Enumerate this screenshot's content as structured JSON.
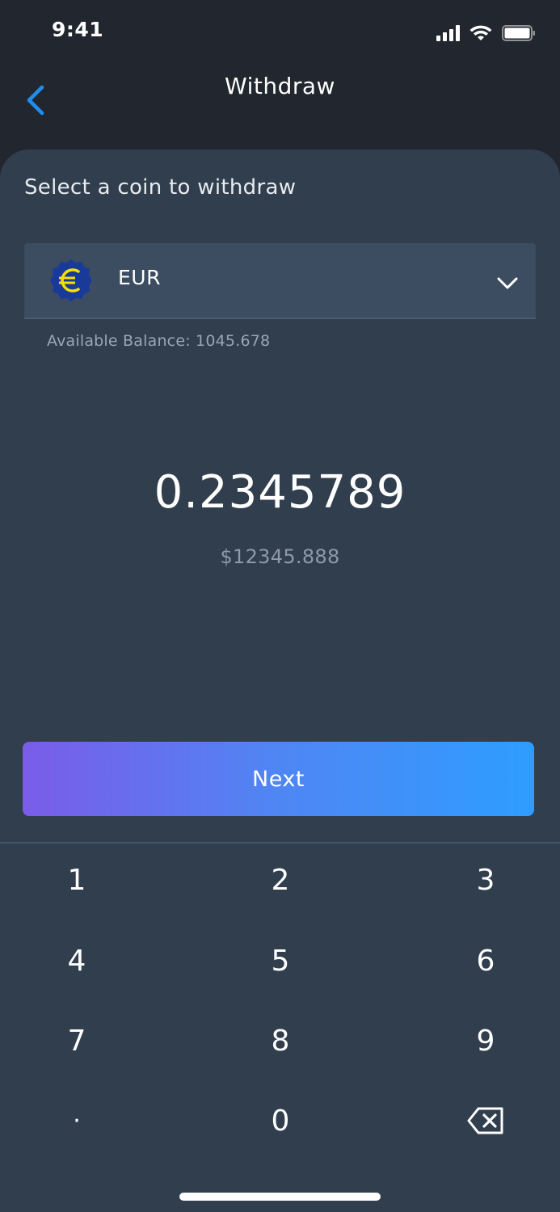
{
  "status_bar": {
    "time": "9:41"
  },
  "header": {
    "title": "Withdraw",
    "back_icon": "chevron-left-icon"
  },
  "coin_section": {
    "label": "Select a coin to withdraw",
    "selected_coin": "EUR",
    "coin_icon": "euro-icon",
    "dropdown_icon": "chevron-down-icon",
    "available_balance": "Available Balance: 1045.678"
  },
  "amount": {
    "value": "0.2345789",
    "fiat_value": "$12345.888"
  },
  "actions": {
    "next_label": "Next"
  },
  "keypad": {
    "keys": [
      "1",
      "2",
      "3",
      "4",
      "5",
      "6",
      "7",
      "8",
      "9",
      "·",
      "0"
    ],
    "backspace_icon": "backspace-icon"
  },
  "colors": {
    "background_top": "#22272f",
    "card": "#313e4e",
    "select_field": "#3c4d61",
    "accent_blue": "#1f8ef1",
    "gradient_start": "#7a5ce9",
    "gradient_end": "#2e9dff",
    "euro_badge": "#1a3a9a",
    "euro_symbol": "#f5e000"
  }
}
